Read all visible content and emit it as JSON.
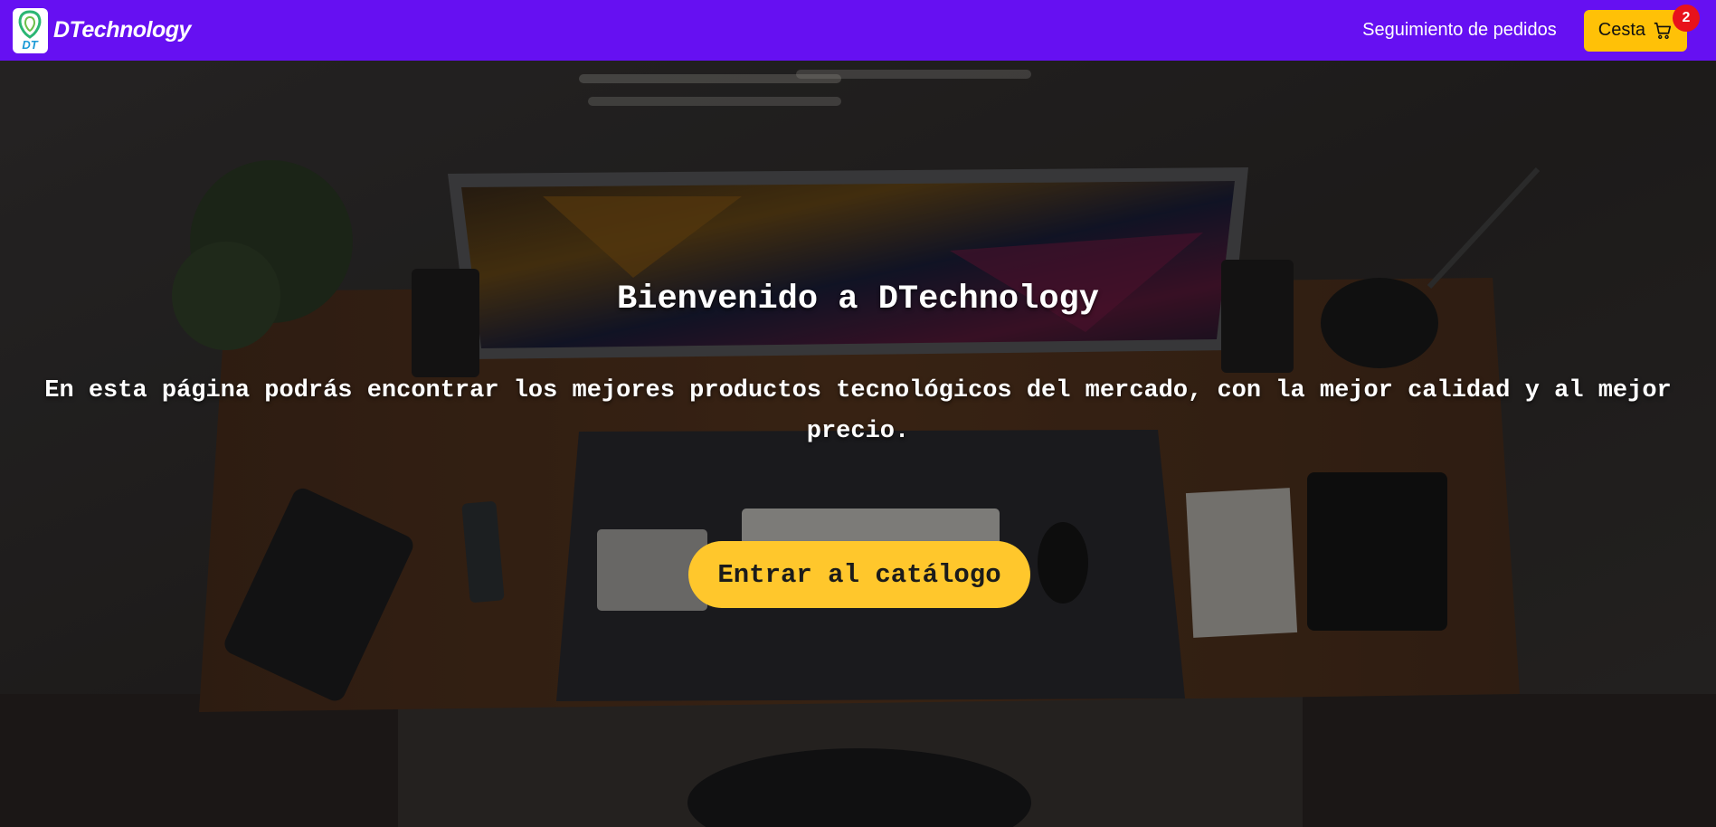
{
  "navbar": {
    "logo_text": "DT",
    "brand_name": "DTechnology",
    "order_tracking_label": "Seguimiento de pedidos",
    "cart_label": "Cesta",
    "cart_count": "2",
    "cart_icon": "shopping-cart-icon"
  },
  "hero": {
    "title": "Bienvenido a DTechnology",
    "subtitle": "En esta página podrás encontrar los mejores productos tecnológicos del mercado, con la mejor calidad y al mejor precio.",
    "cta_label": "Entrar al catálogo",
    "background": "desk-setup-photo"
  },
  "colors": {
    "navbar": "#6610f2",
    "cart_button": "#ffc107",
    "badge": "#e8121b",
    "cta": "#ffc72c"
  }
}
